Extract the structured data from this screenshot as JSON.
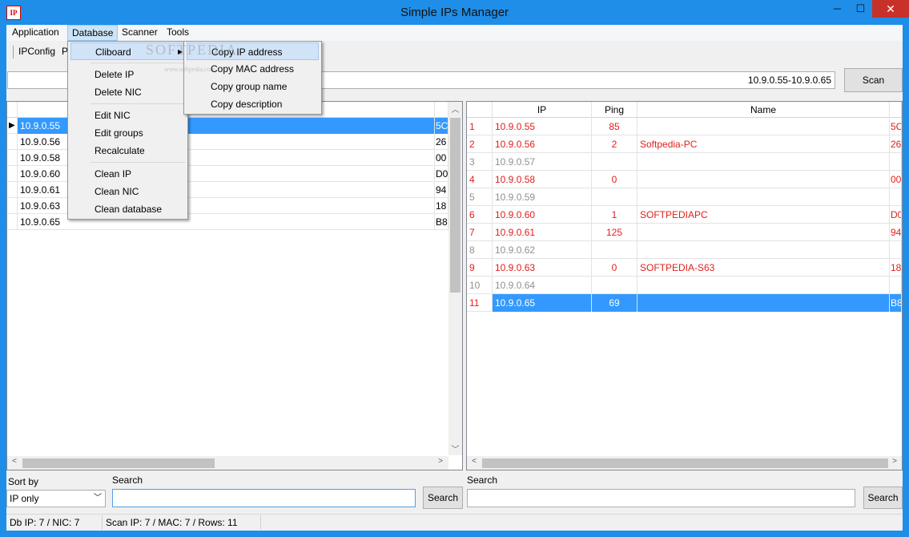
{
  "window": {
    "title": "Simple IPs Manager",
    "icon_text": "IP",
    "minimize": "─",
    "maximize": "☐",
    "close": "✕"
  },
  "menubar": {
    "items": [
      "Application",
      "Database",
      "Scanner",
      "Tools"
    ]
  },
  "toolbar": {
    "ipconfig": "IPConfig",
    "p": "P"
  },
  "scan": {
    "range_value": "10.9.0.55-10.9.0.65",
    "button": "Scan"
  },
  "left_grid": {
    "rows": [
      {
        "ip": "10.9.0.55",
        "mac": "5C",
        "selected": true
      },
      {
        "ip": "10.9.0.56",
        "mac": "26"
      },
      {
        "ip": "10.9.0.58",
        "mac": "00"
      },
      {
        "ip": "10.9.0.60",
        "mac": "D0"
      },
      {
        "ip": "10.9.0.61",
        "mac": "94"
      },
      {
        "ip": "10.9.0.63",
        "mac": "18"
      },
      {
        "ip": "10.9.0.65",
        "mac": "B8"
      }
    ]
  },
  "right_grid": {
    "headers": {
      "ip": "IP",
      "ping": "Ping",
      "name": "Name"
    },
    "rows": [
      {
        "n": "1",
        "ip": "10.9.0.55",
        "ping": "85",
        "name": "",
        "mac": "5C",
        "state": "red"
      },
      {
        "n": "2",
        "ip": "10.9.0.56",
        "ping": "2",
        "name": "Softpedia-PC",
        "mac": "26",
        "state": "red"
      },
      {
        "n": "3",
        "ip": "10.9.0.57",
        "ping": "",
        "name": "",
        "mac": "",
        "state": "gray"
      },
      {
        "n": "4",
        "ip": "10.9.0.58",
        "ping": "0",
        "name": "",
        "mac": "00",
        "state": "red"
      },
      {
        "n": "5",
        "ip": "10.9.0.59",
        "ping": "",
        "name": "",
        "mac": "",
        "state": "gray"
      },
      {
        "n": "6",
        "ip": "10.9.0.60",
        "ping": "1",
        "name": "SOFTPEDIAPC",
        "mac": "D0",
        "state": "red"
      },
      {
        "n": "7",
        "ip": "10.9.0.61",
        "ping": "125",
        "name": "",
        "mac": "94",
        "state": "red"
      },
      {
        "n": "8",
        "ip": "10.9.0.62",
        "ping": "",
        "name": "",
        "mac": "",
        "state": "gray"
      },
      {
        "n": "9",
        "ip": "10.9.0.63",
        "ping": "0",
        "name": "SOFTPEDIA-S63",
        "mac": "18",
        "state": "red"
      },
      {
        "n": "10",
        "ip": "10.9.0.64",
        "ping": "",
        "name": "",
        "mac": "",
        "state": "gray"
      },
      {
        "n": "11",
        "ip": "10.9.0.65",
        "ping": "69",
        "name": "",
        "mac": "B8",
        "state": "selected"
      }
    ]
  },
  "bottom_left": {
    "sort_label": "Sort by",
    "sort_value": "IP only",
    "search_label": "Search",
    "search_value": "",
    "search_button": "Search"
  },
  "bottom_right": {
    "search_label": "Search",
    "search_value": "",
    "search_button": "Search"
  },
  "status": {
    "db": "Db IP: 7 / NIC: 7",
    "scan": "Scan IP: 7 / MAC: 7 / Rows: 11"
  },
  "database_menu": {
    "items": [
      "Cliboard",
      "Delete IP",
      "Delete NIC",
      "Edit NIC",
      "Edit groups",
      "Recalculate",
      "Clean IP",
      "Clean NIC",
      "Clean database"
    ]
  },
  "clipboard_submenu": {
    "items": [
      "Copy IP address",
      "Copy MAC address",
      "Copy group name",
      "Copy description"
    ]
  },
  "watermark": {
    "text": "SOFTPEDIA",
    "url": "www.softpedia.com"
  },
  "colors": {
    "titlebar": "#1e8ee8",
    "selection": "#3399ff",
    "active_row_text": "#e0201c",
    "inactive_row_text": "#909090"
  }
}
